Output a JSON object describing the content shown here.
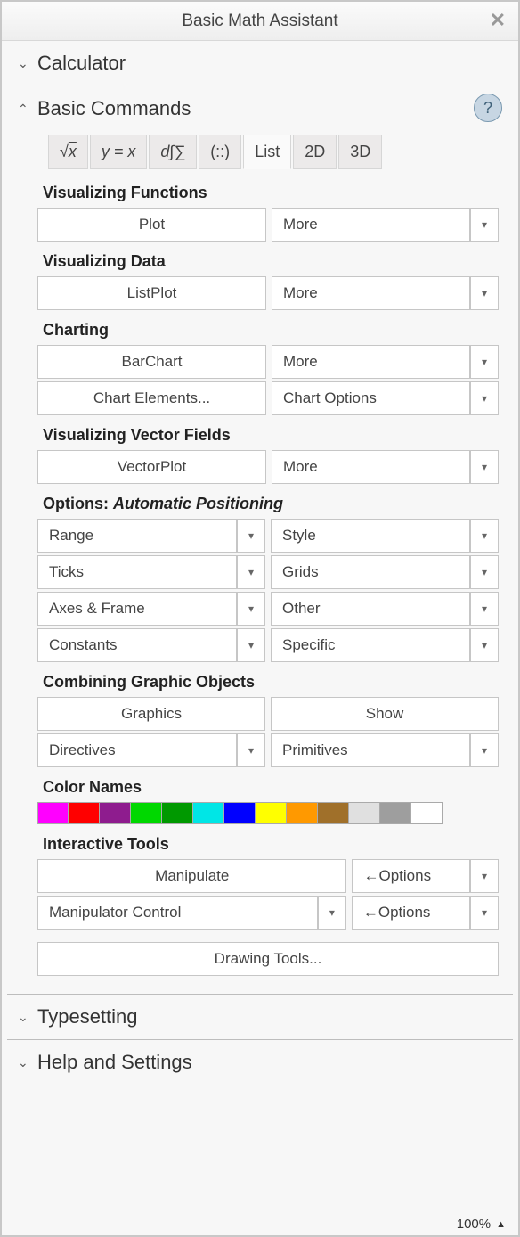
{
  "title": "Basic Math Assistant",
  "sections": {
    "calculator": "Calculator",
    "basic_commands": "Basic Commands",
    "typesetting": "Typesetting",
    "help_settings": "Help and Settings"
  },
  "tabs": {
    "sqrt": "√x",
    "yeqx": "y = x",
    "dsum": "d∫∑",
    "matrix": "(::)",
    "list": "List",
    "d2": "2D",
    "d3": "3D"
  },
  "subheads": {
    "vf": "Visualizing Functions",
    "vd": "Visualizing Data",
    "chart": "Charting",
    "vvf": "Visualizing Vector Fields",
    "options_prefix": "Options: ",
    "options_itext": "Automatic Positioning",
    "combo": "Combining Graphic Objects",
    "colors": "Color Names",
    "inter": "Interactive Tools"
  },
  "labels": {
    "plot": "Plot",
    "more": "More",
    "listplot": "ListPlot",
    "barchart": "BarChart",
    "chartel": "Chart Elements...",
    "chartopt": "Chart Options",
    "vectorplot": "VectorPlot",
    "range": "Range",
    "style": "Style",
    "ticks": "Ticks",
    "grids": "Grids",
    "axesframe": "Axes & Frame",
    "other": "Other",
    "constants": "Constants",
    "specific": "Specific",
    "graphics": "Graphics",
    "show": "Show",
    "directives": "Directives",
    "primitives": "Primitives",
    "manipulate": "Manipulate",
    "optarrow": "←Options",
    "manipctrl": "Manipulator Control",
    "drawing": "Drawing Tools..."
  },
  "colors": [
    "#ff00ff",
    "#ff0000",
    "#8e1c8e",
    "#00d800",
    "#009900",
    "#00e6e6",
    "#0000ff",
    "#ffff00",
    "#ff9900",
    "#a0702a",
    "#e0e0e0",
    "#9e9e9e",
    "#ffffff"
  ],
  "zoom": "100%"
}
